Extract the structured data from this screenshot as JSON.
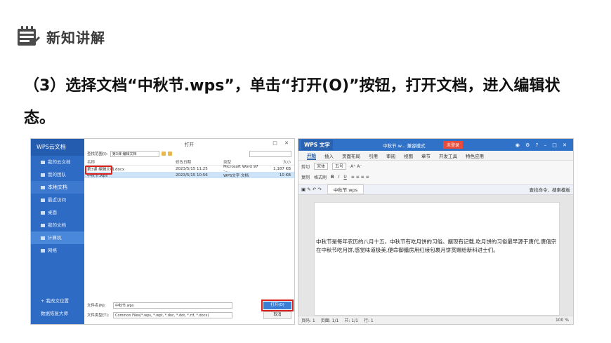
{
  "header": {
    "title": "新知讲解"
  },
  "instruction": "（3）选择文档“中秋节.wps”，单击“打开(O)”按钮，打开文档，进入编辑状态。",
  "left_shot": {
    "brand": "WPS云文档",
    "sidebar": [
      "我的云文档",
      "我的团队"
    ],
    "group": "本地文档",
    "local_items": [
      "最近访问",
      "桌面",
      "我的文档",
      "计算机",
      "网络"
    ],
    "bottom_items": [
      "+ 我改文位置",
      "数据恢复大师"
    ],
    "dialog_title": "打开",
    "look_in_label": "查找范围(I):",
    "look_in_value": "第3课 编辑文档",
    "columns": [
      "名称",
      "修改日期",
      "类型",
      "大小"
    ],
    "files": [
      {
        "name": "第3课 编辑文档.docx",
        "date": "2023/5/15 11:25",
        "type": "Microsoft Word 97 -...",
        "size": "1,187 KB"
      },
      {
        "name": "中秋节.wps",
        "date": "2023/5/15 10:56",
        "type": "WPS文字 文档",
        "size": "10 KB"
      }
    ],
    "filename_label": "文件名(N):",
    "filename_value": "中秋节.wps",
    "filetype_label": "文件类型(T):",
    "filetype_value": "Common Files(*.wps, *.wpt, *.doc, *.dot, *.rtf, *.docx)",
    "open_button": "打开(O)",
    "cancel_button": "取消"
  },
  "right_shot": {
    "app_name": "WPS 文字",
    "doc_title": "中秋节.w... 兼容模式",
    "login": "未登录",
    "menu": [
      "开始",
      "插入",
      "页面布局",
      "引用",
      "审阅",
      "视图",
      "章节",
      "开发工具",
      "特色应用"
    ],
    "toolbar": {
      "cut": "剪切",
      "copy": "复制",
      "format_painter": "格式刷",
      "font": "宋体",
      "size": "五号"
    },
    "doc_tab": "中秋节.wps",
    "find": "查找命令、搜索模板",
    "body_text": "中秋节是每年农历的八月十五，中秋节有吃月饼的习俗。据现有记载,吃月饼的习俗最早源于唐代,唐僖宗在中秋节吃月饼,感觉味道极美,便命御膳房用红绫包裹月饼赏赐给新科进士们。",
    "status": {
      "page": "页码: 1",
      "pages": "页面: 1/1",
      "section": "节: 1/1",
      "row": "行: 1",
      "zoom": "100 %"
    }
  },
  "colors": {
    "wps_blue": "#2e6bc4",
    "highlight_red": "#d9201a",
    "login_red": "#e84b3c"
  }
}
